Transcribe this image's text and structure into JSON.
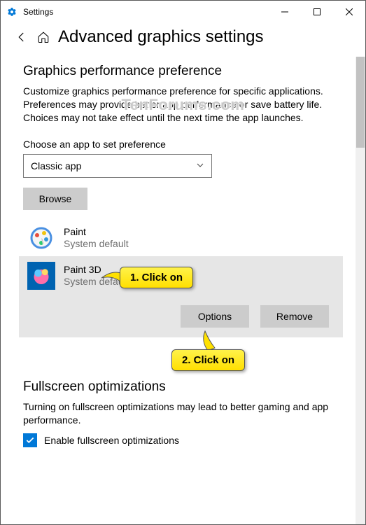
{
  "window": {
    "app_name": "Settings"
  },
  "page": {
    "title": "Advanced graphics settings"
  },
  "watermark": "TenForums.com",
  "perf": {
    "heading": "Graphics performance preference",
    "description": "Customize graphics performance preference for specific applications. Preferences may provide better app performance or save battery life. Choices may not take effect until the next time the app launches.",
    "choose_label": "Choose an app to set preference",
    "dropdown_value": "Classic app",
    "browse_label": "Browse",
    "apps": [
      {
        "name": "Paint",
        "sub": "System default"
      },
      {
        "name": "Paint 3D",
        "sub": "System default"
      }
    ],
    "options_label": "Options",
    "remove_label": "Remove"
  },
  "fullscreen": {
    "heading": "Fullscreen optimizations",
    "description": "Turning on fullscreen optimizations may lead to better gaming and app performance.",
    "checkbox_label": "Enable fullscreen optimizations",
    "checked": true
  },
  "callouts": {
    "c1": "1. Click on",
    "c2": "2. Click on"
  }
}
